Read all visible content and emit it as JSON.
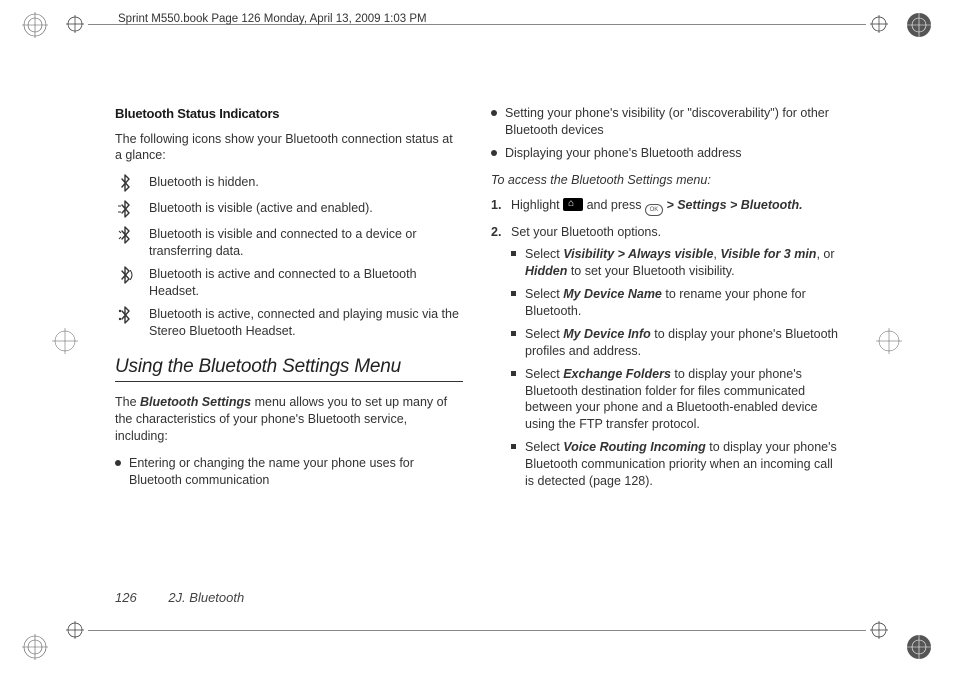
{
  "header": {
    "crumb": "Sprint M550.book  Page 126  Monday, April 13, 2009  1:03 PM"
  },
  "left": {
    "h3": "Bluetooth Status Indicators",
    "intro": "The following icons show your Bluetooth connection status at a glance:",
    "icons": [
      {
        "text": "Bluetooth is hidden."
      },
      {
        "text": "Bluetooth is visible (active and enabled)."
      },
      {
        "text": "Bluetooth is visible and connected to a device or transferring data."
      },
      {
        "text": "Bluetooth is active and connected to a Bluetooth Headset."
      },
      {
        "text": "Bluetooth is active, connected and playing music via the Stereo Bluetooth Headset."
      }
    ],
    "h2": "Using the Bluetooth Settings Menu",
    "desc_pre": "The ",
    "desc_bold": "Bluetooth Settings",
    "desc_post": " menu allows you to set up many of the characteristics of your phone's Bluetooth service, including:",
    "bullets_left": [
      "Entering or changing the name your phone uses for Bluetooth communication"
    ]
  },
  "right": {
    "bullets_top": [
      "Setting your phone's visibility (or \"discoverability\") for other Bluetooth devices",
      "Displaying your phone's Bluetooth address"
    ],
    "instr_intro": "To access the Bluetooth Settings menu:",
    "step1_pre": "Highlight ",
    "step1_mid": " and press ",
    "step1_path": " > Settings > Bluetooth.",
    "step2": "Set your Bluetooth options.",
    "subs": [
      {
        "pre": "Select ",
        "b1": "Visibility > Always visible",
        "mid1": ", ",
        "b2": "Visible for 3 min",
        "mid2": ", or ",
        "b3": "Hidden",
        "post": " to set your Bluetooth visibility."
      },
      {
        "pre": "Select ",
        "b1": "My Device Name",
        "post": " to rename your phone for Bluetooth."
      },
      {
        "pre": "Select ",
        "b1": "My Device Info",
        "post": " to display your phone's Bluetooth profiles and address."
      },
      {
        "pre": "Select ",
        "b1": "Exchange Folders",
        "post": " to display your phone's Bluetooth destination folder for files communicated between your phone and a Bluetooth-enabled device using the FTP transfer protocol."
      },
      {
        "pre": "Select ",
        "b1": "Voice Routing Incoming",
        "post": " to display your phone's Bluetooth communication priority when an incoming call is detected (page 128)."
      }
    ]
  },
  "footer": {
    "page": "126",
    "section": "2J. Bluetooth"
  }
}
